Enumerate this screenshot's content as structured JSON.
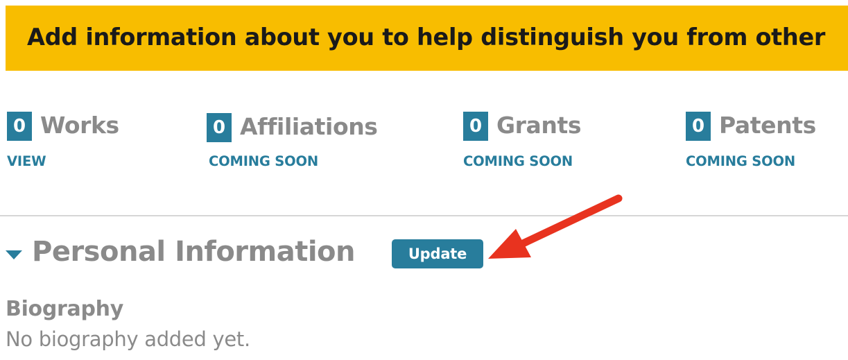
{
  "banner": {
    "text": "Add information about you to help distinguish you from other"
  },
  "stats": [
    {
      "count": "0",
      "label": "Works",
      "link": "VIEW"
    },
    {
      "count": "0",
      "label": "Affiliations",
      "link": "COMING SOON"
    },
    {
      "count": "0",
      "label": "Grants",
      "link": "COMING SOON"
    },
    {
      "count": "0",
      "label": "Patents",
      "link": "COMING SOON"
    }
  ],
  "personal": {
    "title": "Personal Information",
    "update_label": "Update"
  },
  "biography": {
    "heading": "Biography",
    "text": "No biography added yet."
  },
  "colors": {
    "banner": "#f8bd00",
    "accent": "#287d9c",
    "muted_text": "#8a8a8a",
    "annotation_arrow": "#e8331f"
  },
  "icons": {
    "section_toggle": "caret-down-icon",
    "annotation": "red-arrow-pointer"
  }
}
